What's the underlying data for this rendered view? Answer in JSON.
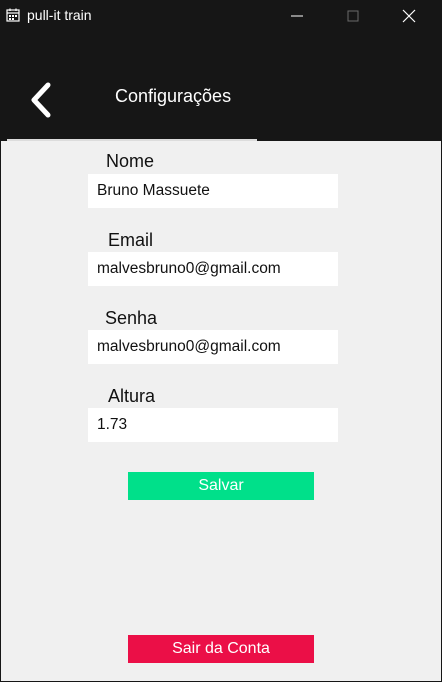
{
  "window": {
    "title": "pull-it train",
    "icon": "calendar-icon",
    "controls": [
      "minimize-icon",
      "maximize-icon",
      "close-icon"
    ]
  },
  "header": {
    "back_icon": "chevron-left-icon",
    "title": "Configurações"
  },
  "form": {
    "nome": {
      "label": "Nome",
      "value": "Bruno Massuete"
    },
    "email": {
      "label": "Email",
      "value": "malvesbruno0@gmail.com"
    },
    "senha": {
      "label": "Senha",
      "value": "malvesbruno0@gmail.com"
    },
    "altura": {
      "label": "Altura",
      "value": "1.73"
    }
  },
  "actions": {
    "save_label": "Salvar",
    "logout_label": "Sair da Conta"
  },
  "colors": {
    "dark_background": "#161616",
    "content_background": "#f0f0f0",
    "save_button": "#00e08a",
    "logout_button": "#eb0f47"
  }
}
